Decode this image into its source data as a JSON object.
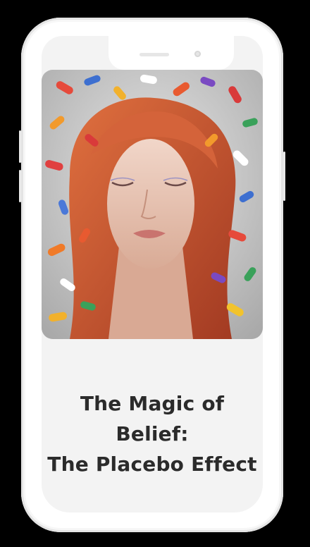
{
  "article": {
    "title_lines": [
      "The Magic of",
      "Belief:",
      "The Placebo Effect"
    ]
  },
  "hero_image": {
    "subject": "woman-with-pills-illustration"
  },
  "colors": {
    "background": "#000000",
    "phone_body": "#ffffff",
    "screen": "#f3f3f3",
    "title_text": "#2b2b2b",
    "hair": "#c85a35"
  }
}
